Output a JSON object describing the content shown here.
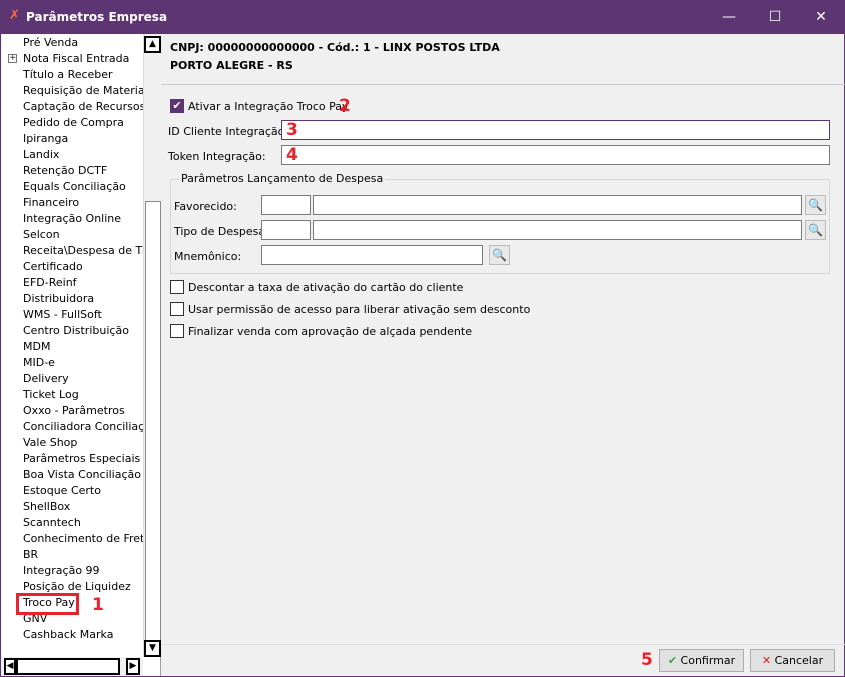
{
  "window": {
    "title": "Parâmetros Empresa",
    "logo_icon": "linx-logo-icon"
  },
  "sidebar": {
    "items": [
      "Pré Venda",
      "Nota Fiscal Entrada",
      "Título a Receber",
      "Requisição de Materiais",
      "Captação de Recursos",
      "Pedido de Compra",
      "Ipiranga",
      "Landix",
      "Retenção DCTF",
      "Equals Conciliação",
      "Financeiro",
      "Integração Online",
      "Selcon",
      "Receita\\Despesa de Titul",
      "Certificado",
      "EFD-Reinf",
      "Distribuidora",
      "WMS - FullSoft",
      "Centro Distribuição",
      "MDM",
      "MID-e",
      "Delivery",
      "Ticket Log",
      "Oxxo - Parâmetros",
      "Conciliadora Conciliação",
      "Vale Shop",
      "Parâmetros Especiais",
      "Boa Vista Conciliação",
      "Estoque Certo",
      "ShellBox",
      "Scanntech",
      "Conhecimento de Frete",
      "BR",
      "Integração 99",
      "Posição de Liquidez",
      "Troco Pay",
      "GNV",
      "Cashback Marka"
    ],
    "selected": "Troco Pay",
    "expandable": "Nota Fiscal Entrada"
  },
  "header": {
    "line1": "CNPJ: 00000000000000 - Cód.: 1 - LINX POSTOS LTDA",
    "line2": "PORTO ALEGRE - RS"
  },
  "form": {
    "ativar_label": "Ativar a Integração Troco Pay",
    "ativar_checked": true,
    "id_cliente_label": "ID Cliente Integração:",
    "id_cliente_value": "",
    "token_label": "Token Integração:",
    "token_value": "",
    "group_title": "Parâmetros Lançamento de Despesa",
    "favorecido_label": "Favorecido:",
    "tipo_label": "Tipo de Despesa:",
    "mnemonico_label": "Mnemônico:",
    "options": [
      {
        "label": "Descontar a taxa de ativação do cartão do cliente",
        "checked": false
      },
      {
        "label": "Usar permissão de acesso para liberar ativação sem desconto",
        "checked": false
      },
      {
        "label": "Finalizar venda com aprovação de alçada pendente",
        "checked": false
      }
    ]
  },
  "footer": {
    "confirm": "Confirmar",
    "cancel": "Cancelar"
  },
  "annotations": [
    "1",
    "2",
    "3",
    "4",
    "5"
  ],
  "colors": {
    "accent": "#5c3572",
    "annotation": "#e8232b"
  }
}
